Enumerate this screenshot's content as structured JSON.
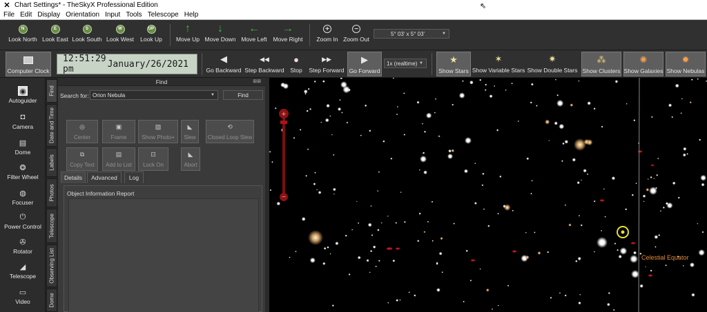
{
  "window": {
    "title": "Chart Settings* - TheSkyX Professional Edition"
  },
  "menu": [
    "File",
    "Edit",
    "Display",
    "Orientation",
    "Input",
    "Tools",
    "Telescope",
    "Help"
  ],
  "toolbar1": {
    "look": [
      {
        "label": "Look North",
        "letter": "N"
      },
      {
        "label": "Look East",
        "letter": "E"
      },
      {
        "label": "Look South",
        "letter": "S"
      },
      {
        "label": "Look West",
        "letter": "W"
      },
      {
        "label": "Look Up",
        "letter": "UP"
      }
    ],
    "move": [
      {
        "label": "Move Up",
        "icon": "arrow-up-icon",
        "glyph": "↑"
      },
      {
        "label": "Move Down",
        "icon": "arrow-down-icon",
        "glyph": "↓"
      },
      {
        "label": "Move Left",
        "icon": "arrow-left-icon",
        "glyph": "←"
      },
      {
        "label": "Move Right",
        "icon": "arrow-right-icon",
        "glyph": "→"
      }
    ],
    "zoom": [
      {
        "label": "Zoom In",
        "glyph": "+"
      },
      {
        "label": "Zoom Out",
        "glyph": "−"
      }
    ],
    "fov": "5° 03' x 5° 03'"
  },
  "toolbar2": {
    "computer_clock": "Computer Clock",
    "time": "12:51:29 pm",
    "date": "January/26/2021",
    "buttons": [
      {
        "label": "Go Backward",
        "glyph": "◀"
      },
      {
        "label": "Step Backward",
        "glyph": "◀◀"
      },
      {
        "label": "Stop",
        "glyph": "●"
      },
      {
        "label": "Step Forward",
        "glyph": "▶▶"
      },
      {
        "label": "Go Forward",
        "glyph": "▶"
      }
    ],
    "rate": "1x (realtime)",
    "show": [
      {
        "label": "Show Stars",
        "glyph": "★"
      },
      {
        "label": "Show Variable Stars",
        "glyph": "✶"
      },
      {
        "label": "Show Double Stars",
        "glyph": "✷"
      },
      {
        "label": "Show Clusters",
        "glyph": "⁂"
      },
      {
        "label": "Show Galaxies",
        "glyph": "✺"
      },
      {
        "label": "Show Nebulas",
        "glyph": "✹"
      }
    ]
  },
  "leftbar": [
    {
      "label": "Autoguider",
      "glyph": "◉",
      "icon": "autoguider-icon"
    },
    {
      "label": "Camera",
      "glyph": "◘",
      "icon": "camera-icon"
    },
    {
      "label": "Dome",
      "glyph": "▤",
      "icon": "dome-icon"
    },
    {
      "label": "Filter Wheel",
      "glyph": "❂",
      "icon": "filter-wheel-icon"
    },
    {
      "label": "Focuser",
      "glyph": "◍",
      "icon": "focuser-icon"
    },
    {
      "label": "Power Control",
      "glyph": "⏻",
      "icon": "power-control-icon"
    },
    {
      "label": "Rotator",
      "glyph": "✇",
      "icon": "rotator-icon"
    },
    {
      "label": "Telescope",
      "glyph": "◢",
      "icon": "telescope-icon"
    },
    {
      "label": "Video",
      "glyph": "▭",
      "icon": "video-icon"
    }
  ],
  "vtabs": [
    "Find",
    "Date and Time",
    "Labels",
    "Photos",
    "Telescope",
    "Observing List",
    "Dome"
  ],
  "find": {
    "header": "Find",
    "search_label": "Search for:",
    "search_value": "Orion Nebula",
    "find_button": "Find",
    "actions": [
      "Center",
      "Frame",
      "Show Photo+",
      "Slew",
      "Closed Loop Slew",
      "Copy Text",
      "Add to List",
      "Lock On",
      "Abort"
    ],
    "tabs": [
      "Details",
      "Advanced",
      "Log"
    ],
    "report_label": "Object Information Report"
  },
  "sky": {
    "equator_label": "Celestial Equator"
  }
}
